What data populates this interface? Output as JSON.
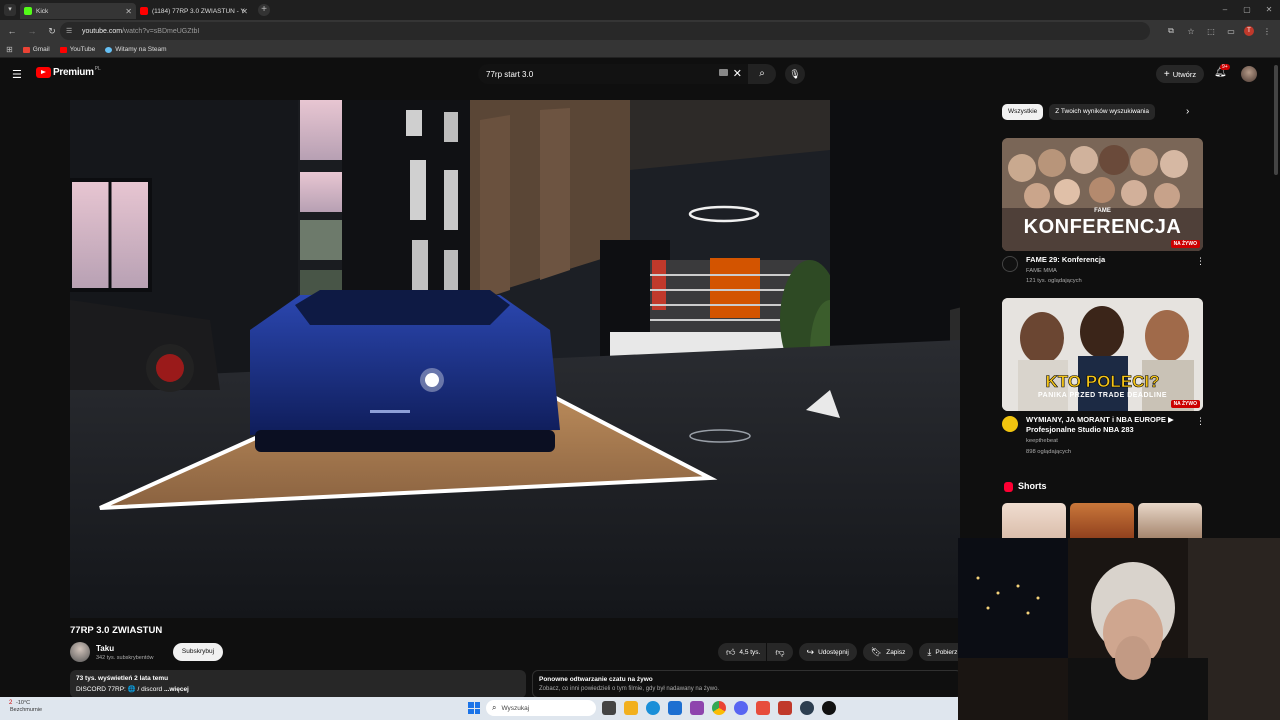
{
  "browser": {
    "tabs": [
      {
        "label": "Kick",
        "active": true,
        "favicon_color": "#53fc18"
      },
      {
        "label": "(1184) 77RP 3.0 ZWIASTUN - Y",
        "active": false,
        "favicon_color": "#ff0000"
      }
    ],
    "url_host": "youtube.com",
    "url_path": "/watch?v=sBDmeUGZtbI",
    "bookmarks": [
      {
        "label": "Gmail",
        "color": "#ea4335"
      },
      {
        "label": "YouTube",
        "color": "#ff0000"
      },
      {
        "label": "Witamy na Steam",
        "color": "#66c0f4"
      }
    ]
  },
  "youtube": {
    "logo_text": "Premium",
    "logo_region": "PL",
    "search_query": "77rp start 3.0",
    "create_label": "Utwórz",
    "notifications_badge": "9+"
  },
  "video": {
    "title": "77RP 3.0 ZWIASTUN",
    "channel": "Taku",
    "subscribers": "342 tys. subskrybentów",
    "subscribe_label": "Subskrybuj",
    "actions": {
      "likes": "4,5 tys.",
      "share": "Udostępnij",
      "save": "Zapisz",
      "download": "Pobierz"
    },
    "description": {
      "stats": "73 tys. wyświetleń  2 lata temu",
      "text": "DISCORD 77RP: 🌐 / discord",
      "more": "...więcej"
    },
    "chat_replay": {
      "title": "Ponowne odtwarzanie czatu na żywo",
      "subtitle": "Zobacz, co inni powiedzieli o tym filmie, gdy był nadawany na żywo."
    }
  },
  "sidebar": {
    "chips": [
      "Wszystkie",
      "Z Twoich wyników wyszukiwania"
    ],
    "cards": [
      {
        "thumb_text": "KONFERENCJA",
        "thumb_brand": "FAME",
        "badge": "NA ŻYWO",
        "title": "FAME 29: Konferencja",
        "channel": "FAME MMA",
        "views": "121 tys. oglądających"
      },
      {
        "thumb_text": "KTO POLECI?",
        "thumb_subtext": "PANIKA PRZED TRADE DEADLINE",
        "badge": "NA ŻYWO",
        "title": "WYMIANY, JA MORANT i NBA EUROPE ▶ Profesjonalne Studio NBA 283",
        "channel": "keepthebeat",
        "views": "898 oglądających"
      }
    ],
    "shorts_label": "Shorts"
  },
  "taskbar": {
    "weather_temp": "-10°C",
    "weather_desc": "Bezchmurnie",
    "notif_count": "2",
    "search_placeholder": "Wyszukaj"
  }
}
